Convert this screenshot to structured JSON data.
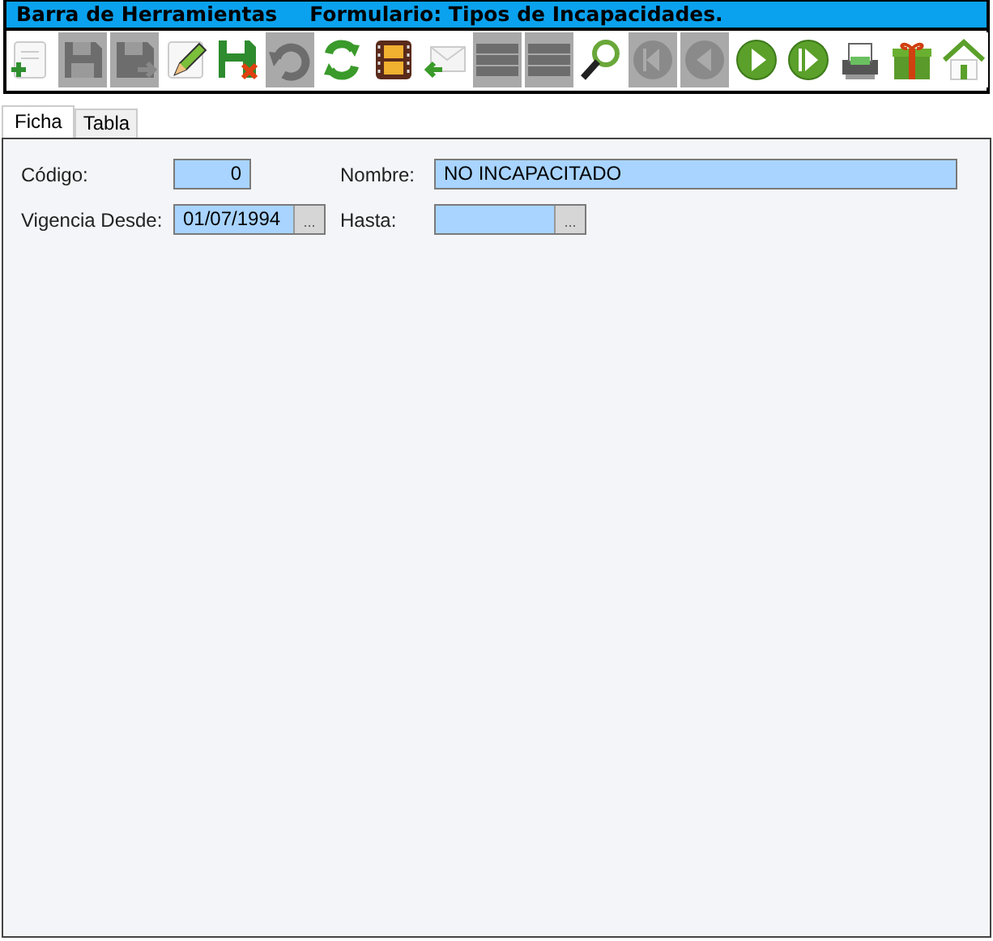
{
  "title_bar": {
    "toolbar_name": "Barra de Herramientas",
    "form_name": "Formulario: Tipos de Incapacidades."
  },
  "toolbar": [
    {
      "kind": "new",
      "disabled": false
    },
    {
      "kind": "save",
      "disabled": true
    },
    {
      "kind": "save_as",
      "disabled": true
    },
    {
      "kind": "edit",
      "disabled": false
    },
    {
      "kind": "delete",
      "disabled": false
    },
    {
      "kind": "undo",
      "disabled": true
    },
    {
      "kind": "refresh",
      "disabled": false
    },
    {
      "kind": "film",
      "disabled": false
    },
    {
      "kind": "mail",
      "disabled": false
    },
    {
      "kind": "list",
      "disabled": true
    },
    {
      "kind": "list",
      "disabled": true
    },
    {
      "kind": "search",
      "disabled": false
    },
    {
      "kind": "first",
      "disabled": true
    },
    {
      "kind": "previous",
      "disabled": true
    },
    {
      "kind": "next",
      "disabled": false
    },
    {
      "kind": "last",
      "disabled": false
    },
    {
      "kind": "print",
      "disabled": false
    },
    {
      "kind": "gift",
      "disabled": false
    },
    {
      "kind": "home",
      "disabled": false
    }
  ],
  "tabs": [
    {
      "label": "Ficha",
      "selected": true
    },
    {
      "label": "Tabla",
      "selected": false
    }
  ],
  "form": {
    "rows": [
      [
        {
          "label": "Código:",
          "kind": "number",
          "value": "0"
        },
        {
          "label": "Nombre:",
          "kind": "text",
          "value": "NO INCAPACITADO"
        }
      ],
      [
        {
          "label": "Vigencia Desde:",
          "kind": "date",
          "value": "01/07/1994",
          "picker": "..."
        },
        {
          "label": "Hasta:",
          "kind": "date",
          "picker": "..."
        }
      ]
    ]
  }
}
